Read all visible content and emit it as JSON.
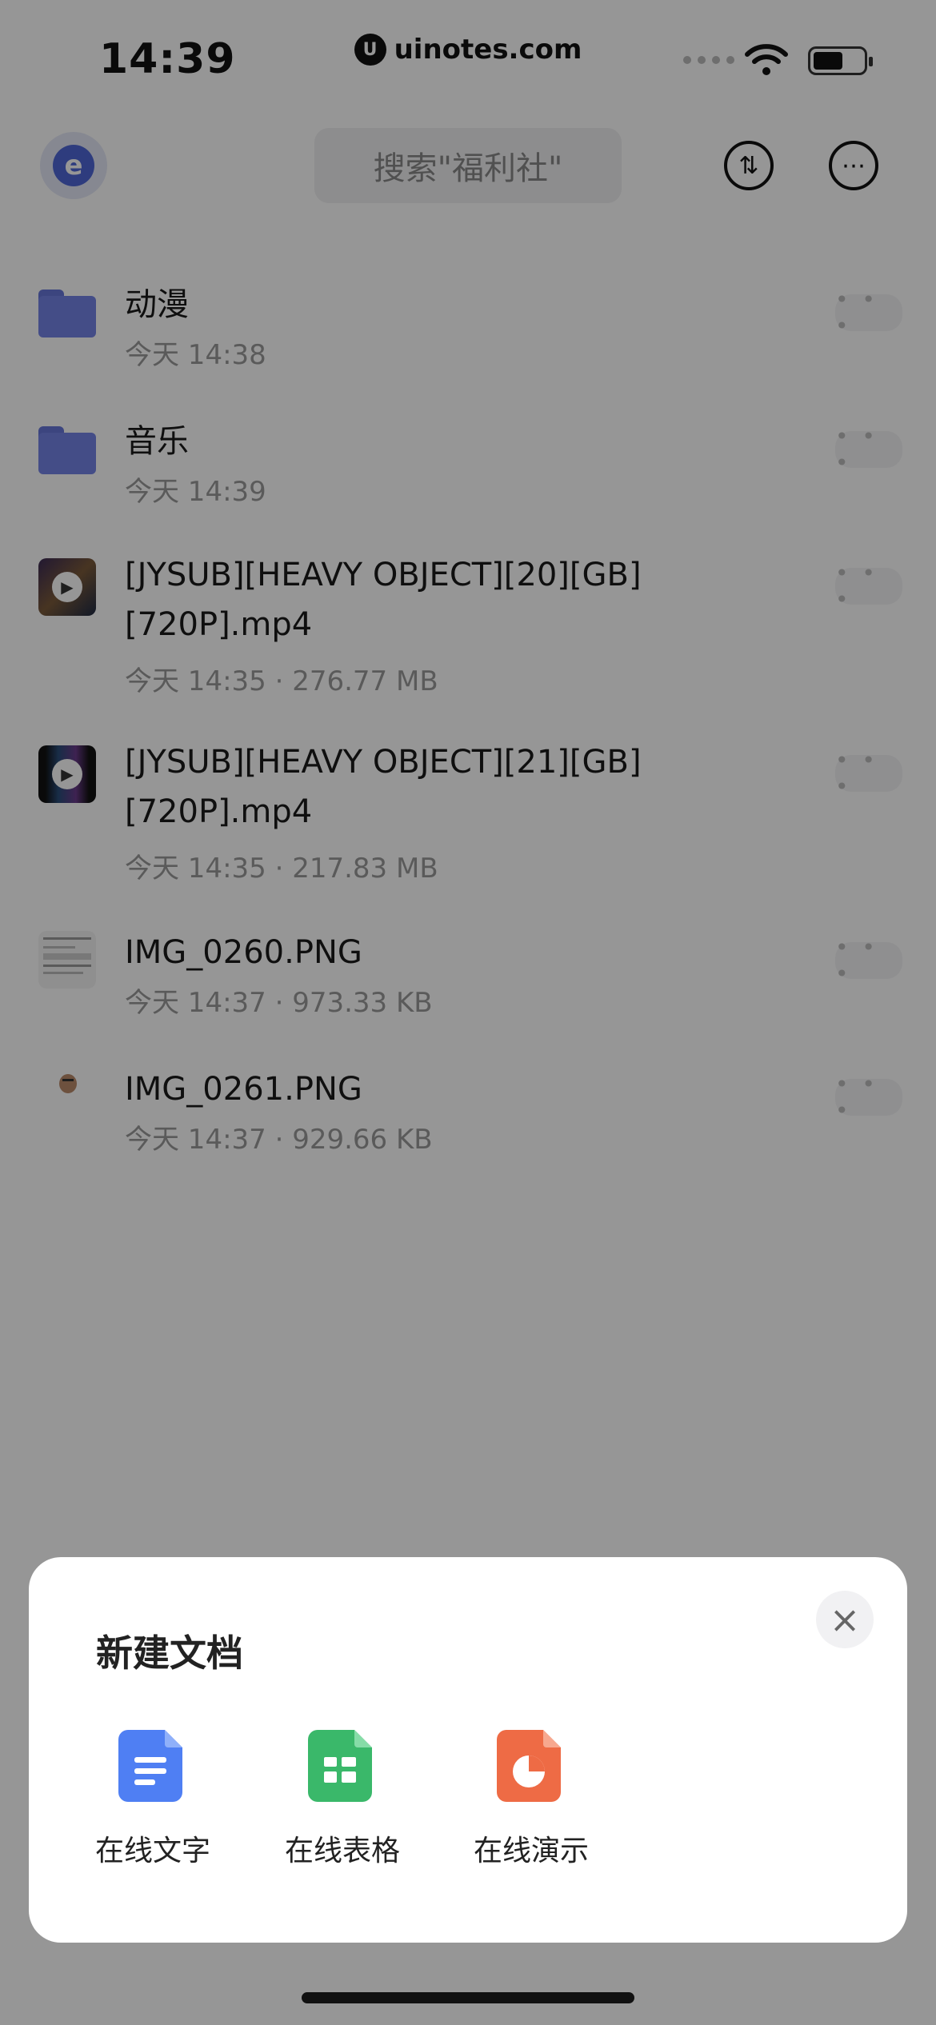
{
  "status_bar": {
    "time": "14:39"
  },
  "watermark": {
    "text": "uinotes.com",
    "badge": "U"
  },
  "header": {
    "avatar_glyph": "e",
    "search_placeholder": "搜索\"福利社\"",
    "sort_icon": "sort-icon",
    "more_icon": "more-icon"
  },
  "files": [
    {
      "title": "动漫",
      "meta": "今天 14:38",
      "kind": "folder"
    },
    {
      "title": "音乐",
      "meta": "今天 14:39",
      "kind": "folder"
    },
    {
      "title": "[JYSUB][HEAVY OBJECT][20][GB][720P].mp4",
      "meta": "今天 14:35 · 276.77 MB",
      "kind": "video"
    },
    {
      "title": "[JYSUB][HEAVY OBJECT][21][GB][720P].mp4",
      "meta": "今天 14:35 · 217.83 MB",
      "kind": "video"
    },
    {
      "title": "IMG_0260.PNG",
      "meta": "今天 14:37 · 973.33 KB",
      "kind": "image"
    },
    {
      "title": "IMG_0261.PNG",
      "meta": "今天 14:37 · 929.66 KB",
      "kind": "image"
    }
  ],
  "row_more_label": "• • •",
  "sheet": {
    "title": "新建文档",
    "close_icon": "×",
    "options": [
      {
        "label": "在线文字",
        "color": "#4f7ff3",
        "icon": "doc-icon"
      },
      {
        "label": "在线表格",
        "color": "#3ab86a",
        "icon": "sheet-icon"
      },
      {
        "label": "在线演示",
        "color": "#ee6b45",
        "icon": "slides-icon"
      }
    ]
  }
}
